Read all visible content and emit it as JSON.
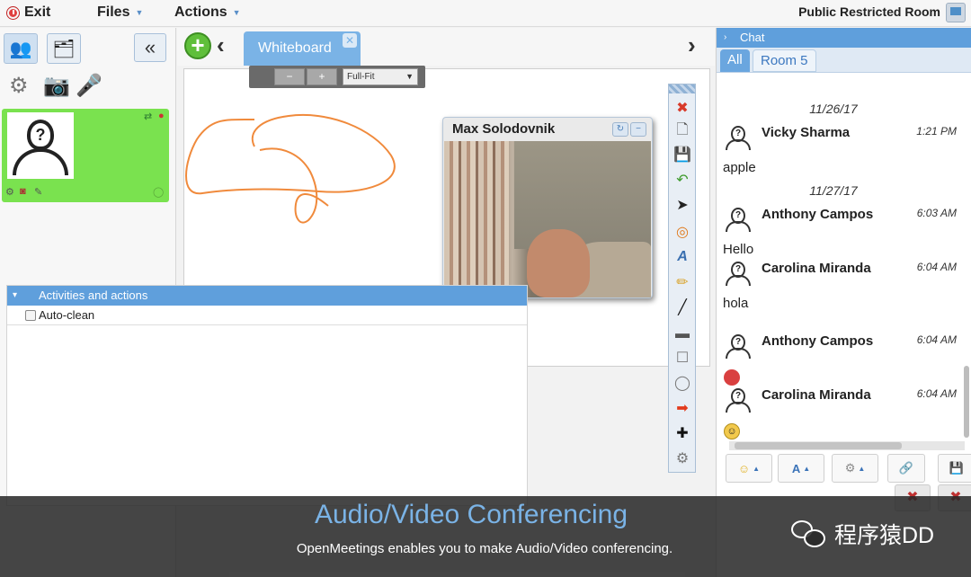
{
  "topbar": {
    "exit_label": "Exit",
    "files_label": "Files",
    "actions_label": "Actions",
    "room_name": "Public Restricted Room"
  },
  "left": {
    "collapse_label": "«"
  },
  "whiteboard": {
    "tab_label": "Whiteboard",
    "zoom_minus": "−",
    "zoom_plus": "+",
    "zoom_mode": "Full-Fit",
    "video_title": "Max Solodovnik"
  },
  "activities": {
    "header": "Activities and actions",
    "auto_clean_label": "Auto-clean"
  },
  "chat": {
    "header": "Chat",
    "tabs": [
      "All",
      "Room 5"
    ],
    "dates": [
      "11/26/17",
      "11/27/17"
    ],
    "messages": [
      {
        "name": "Vicky Sharma",
        "time": "1:21 PM",
        "text": "apple"
      },
      {
        "name": "Anthony Campos",
        "time": "6:03 AM",
        "text": "Hello"
      },
      {
        "name": "Carolina Miranda",
        "time": "6:04 AM",
        "text": "hola"
      },
      {
        "name": "Anthony Campos",
        "time": "6:04 AM",
        "text": ""
      },
      {
        "name": "Carolina Miranda",
        "time": "6:04 AM",
        "text": ""
      }
    ]
  },
  "caption": {
    "title": "Audio/Video Conferencing",
    "subtitle": "OpenMeetings enables you to make Audio/Video conferencing.",
    "watermark": "程序猿DD"
  },
  "colors": {
    "accent": "#5f9fdc",
    "user_card": "#7ae24f",
    "caption_title": "#7ab3e6",
    "pen_stroke": "#f08a3c"
  }
}
